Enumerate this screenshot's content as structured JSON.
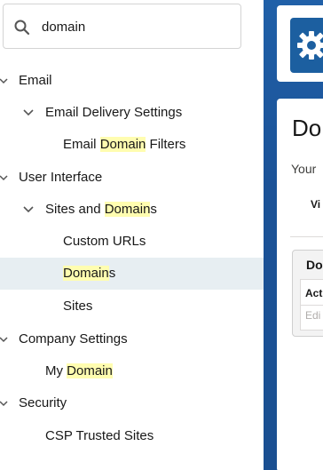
{
  "search": {
    "value": "domain"
  },
  "tree": {
    "items": [
      {
        "id": "email",
        "label_parts": [
          {
            "text": "Email",
            "hl": false
          }
        ]
      },
      {
        "id": "email-delivery-settings",
        "label_parts": [
          {
            "text": "Email Delivery Settings",
            "hl": false
          }
        ]
      },
      {
        "id": "email-domain-filters",
        "label_parts": [
          {
            "text": "Email ",
            "hl": false
          },
          {
            "text": "Domain",
            "hl": true
          },
          {
            "text": " Filters",
            "hl": false
          }
        ]
      },
      {
        "id": "user-interface",
        "label_parts": [
          {
            "text": "User Interface",
            "hl": false
          }
        ]
      },
      {
        "id": "sites-and-domains",
        "label_parts": [
          {
            "text": "Sites and ",
            "hl": false
          },
          {
            "text": "Domain",
            "hl": true
          },
          {
            "text": "s",
            "hl": false
          }
        ]
      },
      {
        "id": "custom-urls",
        "label_parts": [
          {
            "text": "Custom URLs",
            "hl": false
          }
        ]
      },
      {
        "id": "domains",
        "label_parts": [
          {
            "text": "Domain",
            "hl": true
          },
          {
            "text": "s",
            "hl": false
          }
        ]
      },
      {
        "id": "sites",
        "label_parts": [
          {
            "text": "Sites",
            "hl": false
          }
        ]
      },
      {
        "id": "company-settings",
        "label_parts": [
          {
            "text": "Company Settings",
            "hl": false
          }
        ]
      },
      {
        "id": "my-domain",
        "label_parts": [
          {
            "text": "My ",
            "hl": false
          },
          {
            "text": "Domain",
            "hl": true
          }
        ]
      },
      {
        "id": "security",
        "label_parts": [
          {
            "text": "Security",
            "hl": false
          }
        ]
      },
      {
        "id": "csp-trusted-sites",
        "label_parts": [
          {
            "text": "CSP Trusted Sites",
            "hl": false
          }
        ]
      }
    ]
  },
  "right": {
    "page_title": "Do",
    "subtitle": "Your",
    "view_label": "Vi",
    "card_title": "Do",
    "col_header": "Act",
    "row_action": "Edi"
  },
  "colors": {
    "highlight": "#fffdb0",
    "selected": "#e7eef2",
    "brand": "#1b5297"
  }
}
